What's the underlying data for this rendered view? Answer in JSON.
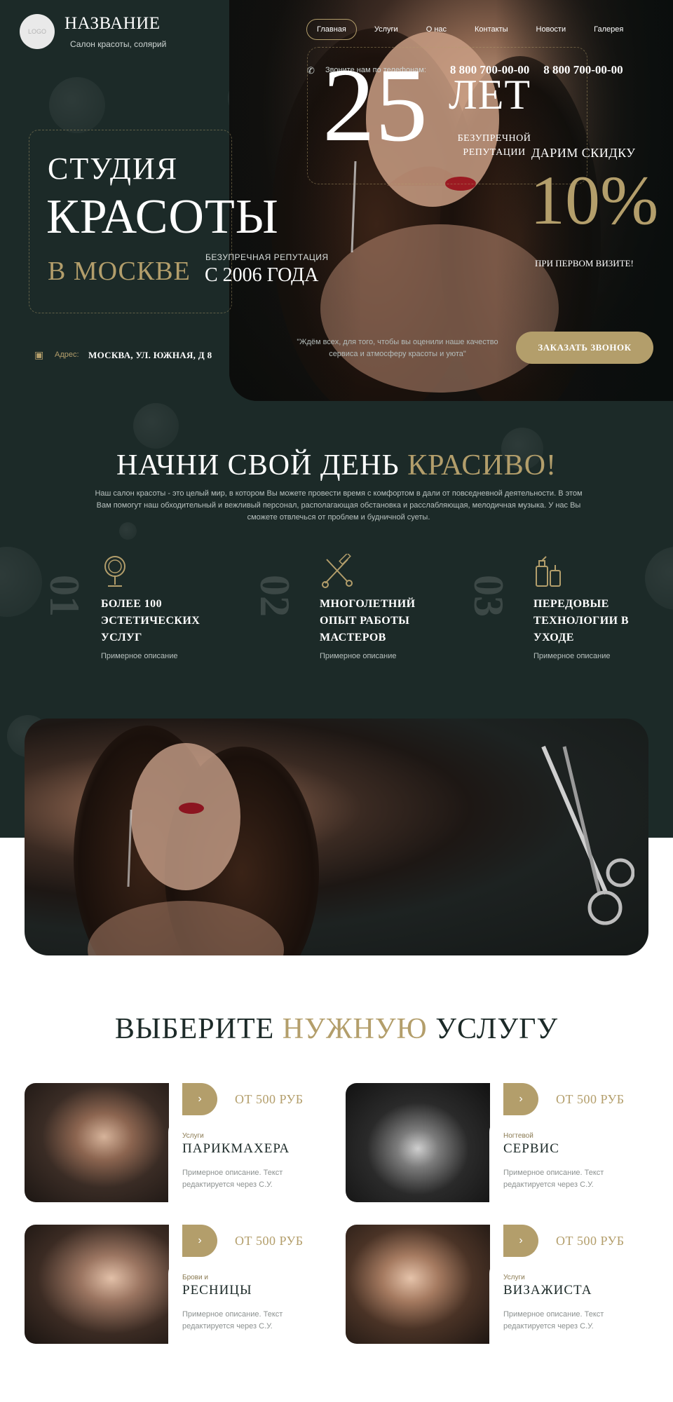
{
  "header": {
    "logo_text": "LOGO",
    "brand_name": "НАЗВАНИЕ",
    "brand_sub": "Салон красоты, солярий",
    "nav": [
      "Главная",
      "Услуги",
      "О нас",
      "Контакты",
      "Новости",
      "Галерея"
    ],
    "active_nav": "Главная",
    "phone_label": "Звоните нам по телефонам:",
    "phones": [
      "8 800 700-00-00",
      "8 800 700-00-00"
    ]
  },
  "hero": {
    "line1": "СТУДИЯ",
    "line2": "КРАСОТЫ",
    "line3": "В МОСКВЕ",
    "reputation": "БЕЗУПРЕЧНАЯ РЕПУТАЦИЯ",
    "since": "С 2006 ГОДА",
    "discount_title": "ДАРИМ СКИДКУ",
    "discount_value": "10%",
    "discount_note": "ПРИ ПЕРВОМ ВИЗИТЕ!",
    "address_label": "Адрес:",
    "address_value": "МОСКВА, УЛ. ЮЖНАЯ, Д 8",
    "quote": "\"Ждём всех, для того, чтобы вы оценили наше качество сервиса и атмосферу красоты и уюта\"",
    "cta": "ЗАКАЗАТЬ ЗВОНОК"
  },
  "about": {
    "title_main": "НАЧНИ СВОЙ ДЕНЬ",
    "title_accent": "КРАСИВО!",
    "text": "Наш салон красоты - это целый мир, в котором Вы можете провести время с комфортом в дали от повседневной деятельности. В этом Вам помогут наш обходительный и вежливый персонал, располагающая обстановка и расслабляющая, мелодичная музыка. У нас Вы сможете отвлечься от проблем и будничной суеты.",
    "features": [
      {
        "num": "01",
        "icon": "mirror-icon",
        "title": "БОЛЕЕ 100 ЭСТЕТИЧЕСКИХ УСЛУГ",
        "desc": "Примерное описание"
      },
      {
        "num": "02",
        "icon": "scissors-comb-icon",
        "title": "МНОГОЛЕТНИЙ ОПЫТ РАБОТЫ МАСТЕРОВ",
        "desc": "Примерное описание"
      },
      {
        "num": "03",
        "icon": "cosmetics-icon",
        "title": "ПЕРЕДОВЫЕ ТЕХНОЛОГИИ В УХОДЕ",
        "desc": "Примерное описание"
      }
    ]
  },
  "banner": {
    "number": "25",
    "years": "ЛЕТ",
    "sub": "БЕЗУПРЕЧНОЙ РЕПУТАЦИИ"
  },
  "services": {
    "title_a": "ВЫБЕРИТЕ",
    "title_accent": "НУЖНУЮ",
    "title_b": "УСЛУГУ",
    "cards": [
      {
        "price": "ОТ 500 РУБ",
        "category": "Услуги",
        "name": "ПАРИКМАХЕРА",
        "desc": "Примерное описание. Текст редактируется через С.У."
      },
      {
        "price": "ОТ 500 РУБ",
        "category": "Ногтевой",
        "name": "СЕРВИС",
        "desc": "Примерное описание. Текст редактируется через С.У."
      },
      {
        "price": "ОТ 500 РУБ",
        "category": "Брови и",
        "name": "РЕСНИЦЫ",
        "desc": "Примерное описание. Текст редактируется через С.У."
      },
      {
        "price": "ОТ 500 РУБ",
        "category": "Услуги",
        "name": "ВИЗАЖИСТА",
        "desc": "Примерное описание. Текст редактируется через С.У."
      }
    ]
  },
  "colors": {
    "dark": "#1c2a28",
    "gold": "#b39e6b",
    "white": "#ffffff"
  }
}
